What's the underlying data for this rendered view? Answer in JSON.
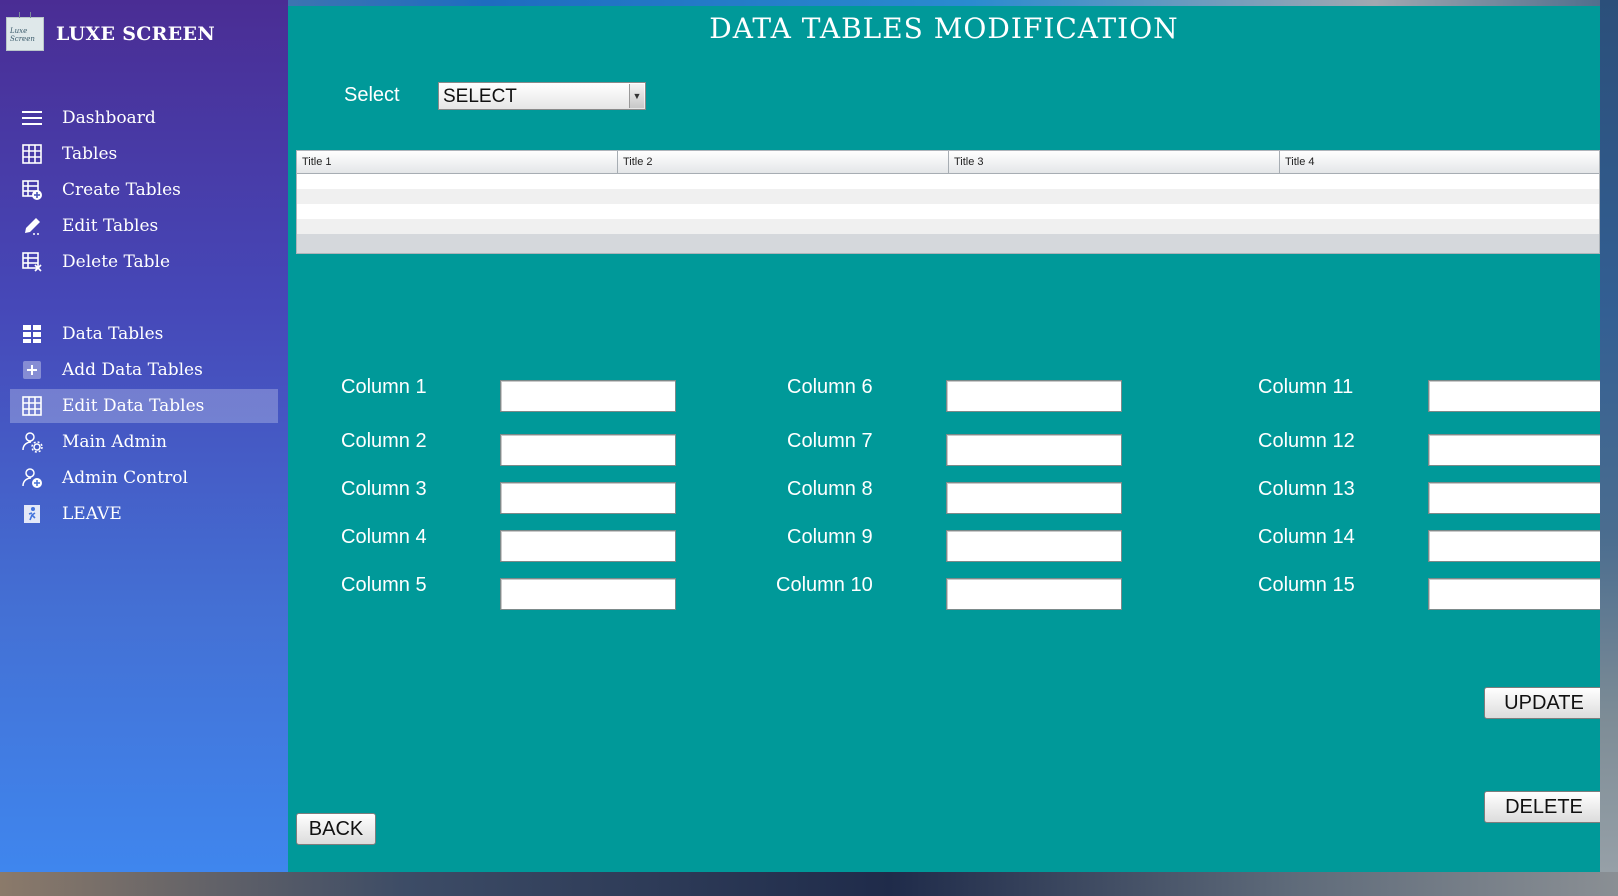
{
  "brand": {
    "name": "LUXE SCREEN",
    "logo_text": "Luxe Screen"
  },
  "sidebar": {
    "items": [
      {
        "label": "Dashboard",
        "icon": "menu-icon"
      },
      {
        "label": "Tables",
        "icon": "table-grid-icon"
      },
      {
        "label": "Create Tables",
        "icon": "table-add-icon"
      },
      {
        "label": "Edit Tables",
        "icon": "pencil-icon"
      },
      {
        "label": "Delete Table",
        "icon": "table-delete-icon"
      },
      {
        "label": "Data Tables",
        "icon": "data-table-icon"
      },
      {
        "label": "Add Data Tables",
        "icon": "plus-box-icon"
      },
      {
        "label": "Edit Data Tables",
        "icon": "table-grid-icon",
        "active": true
      },
      {
        "label": "Main Admin",
        "icon": "admin-gear-icon"
      },
      {
        "label": "Admin Control",
        "icon": "admin-add-icon"
      },
      {
        "label": "LEAVE",
        "icon": "exit-icon"
      }
    ]
  },
  "main": {
    "title": "DATA TABLES MODIFICATION",
    "select_label": "Select",
    "select_value": "SELECT",
    "table": {
      "headers": [
        "Title 1",
        "Title 2",
        "Title 3",
        "Title 4"
      ],
      "rows": [
        [
          "",
          "",
          "",
          ""
        ],
        [
          "",
          "",
          "",
          ""
        ],
        [
          "",
          "",
          "",
          ""
        ],
        [
          "",
          "",
          "",
          ""
        ]
      ]
    },
    "columns": [
      {
        "label": "Column 1",
        "value": ""
      },
      {
        "label": "Column 2",
        "value": ""
      },
      {
        "label": "Column 3",
        "value": ""
      },
      {
        "label": "Column 4",
        "value": ""
      },
      {
        "label": "Column 5",
        "value": ""
      },
      {
        "label": "Column 6",
        "value": ""
      },
      {
        "label": "Column 7",
        "value": ""
      },
      {
        "label": "Column 8",
        "value": ""
      },
      {
        "label": "Column 9",
        "value": ""
      },
      {
        "label": "Column 10",
        "value": ""
      },
      {
        "label": "Column 11",
        "value": ""
      },
      {
        "label": "Column 12",
        "value": ""
      },
      {
        "label": "Column 13",
        "value": ""
      },
      {
        "label": "Column 14",
        "value": ""
      },
      {
        "label": "Column 15",
        "value": ""
      }
    ],
    "buttons": {
      "update": "UPDATE",
      "delete": "DELETE",
      "back": "BACK"
    }
  },
  "colors": {
    "main_bg": "#009999",
    "sidebar_top": "#4a2d94",
    "sidebar_bottom": "#3f86ee"
  }
}
